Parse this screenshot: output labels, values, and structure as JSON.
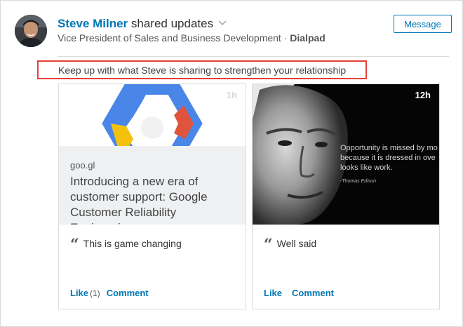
{
  "header": {
    "author_name": "Steve Milner",
    "shared_text": " shared updates",
    "subtitle_role": "Vice President of Sales and Business Development · ",
    "subtitle_company": "Dialpad",
    "message_label": "Message",
    "nudge_text": "Keep up with what Steve is sharing to strengthen your relationship"
  },
  "posts": [
    {
      "time": "1h",
      "domain": "goo.gl",
      "title": "Introducing a new era of customer support: Google Customer Reliability Engineeri...",
      "comment": "This is game changing",
      "like_label": "Like",
      "like_count": "(1)",
      "comment_label": "Comment"
    },
    {
      "time": "12h",
      "quote_lines": [
        "Opportunity is missed by mo",
        "because it is dressed in ove",
        "looks like work."
      ],
      "quote_attribution": "-Thomas Edison",
      "comment": "Well said",
      "like_label": "Like",
      "comment_label": "Comment"
    }
  ],
  "icons": {
    "quote": "“",
    "chevron": "chevron-down-icon"
  },
  "colors": {
    "link_blue": "#0077b5",
    "highlight_red": "#e3423a",
    "google_blue": "#4a86e8",
    "google_red": "#e0533d",
    "google_yellow": "#f4c20d",
    "google_green": "#34a853"
  }
}
